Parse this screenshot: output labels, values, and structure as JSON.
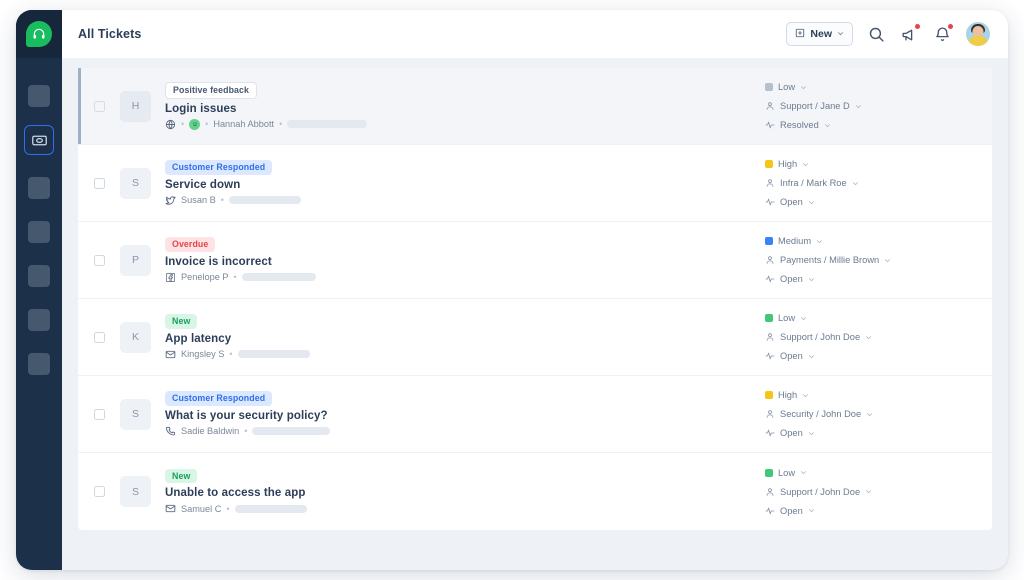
{
  "app": {
    "brand_icon": "headset-icon",
    "sidebar": {
      "items": [
        {
          "name": "nav-placeholder-1",
          "icon": "square-placeholder-icon",
          "active": false
        },
        {
          "name": "nav-tickets",
          "icon": "ticket-icon",
          "active": true
        },
        {
          "name": "nav-placeholder-3",
          "icon": "square-placeholder-icon",
          "active": false
        },
        {
          "name": "nav-placeholder-4",
          "icon": "square-placeholder-icon",
          "active": false
        },
        {
          "name": "nav-placeholder-5",
          "icon": "square-placeholder-icon",
          "active": false
        },
        {
          "name": "nav-placeholder-6",
          "icon": "square-placeholder-icon",
          "active": false
        },
        {
          "name": "nav-placeholder-7",
          "icon": "square-placeholder-icon",
          "active": false
        }
      ]
    }
  },
  "header": {
    "title": "All Tickets",
    "new_button": {
      "label": "New",
      "icon": "plus-square-icon",
      "chevron": "chevron-down-icon"
    },
    "icons": [
      {
        "name": "search-icon",
        "badge": false
      },
      {
        "name": "megaphone-icon",
        "badge": true
      },
      {
        "name": "bell-icon",
        "badge": true
      }
    ],
    "avatar": "user-avatar"
  },
  "colors": {
    "priority_low_gray": "#b6bfcc",
    "priority_low_green": "#3fc977",
    "priority_high_yellow": "#f5c518",
    "priority_medium_blue": "#3b82f6",
    "accent_blue": "#2f6fed",
    "brand_green": "#17bd5f",
    "sidebar_bg": "#1c3049"
  },
  "tickets": [
    {
      "selected": true,
      "initial": "H",
      "badge": {
        "label": "Positive feedback",
        "style": "neutral"
      },
      "title": "Login issues",
      "channel_icon": "globe-icon",
      "sentiment_icon": "smiley-happy-icon",
      "requester": "Hannah Abbott",
      "redacted_width": 80,
      "priority": {
        "label": "Low",
        "color": "#b6bfcc"
      },
      "assignee": "Support / Jane D",
      "status": "Resolved"
    },
    {
      "selected": false,
      "initial": "S",
      "badge": {
        "label": "Customer Responded",
        "style": "blue"
      },
      "title": "Service down",
      "channel_icon": "twitter-icon",
      "sentiment_icon": null,
      "requester": "Susan B",
      "redacted_width": 72,
      "priority": {
        "label": "High",
        "color": "#f5c518"
      },
      "assignee": "Infra / Mark Roe",
      "status": "Open"
    },
    {
      "selected": false,
      "initial": "P",
      "badge": {
        "label": "Overdue",
        "style": "red"
      },
      "title": "Invoice is incorrect",
      "channel_icon": "facebook-icon",
      "sentiment_icon": null,
      "requester": "Penelope P",
      "redacted_width": 74,
      "priority": {
        "label": "Medium",
        "color": "#3b82f6"
      },
      "assignee": "Payments / Millie Brown",
      "status": "Open"
    },
    {
      "selected": false,
      "initial": "K",
      "badge": {
        "label": "New",
        "style": "green"
      },
      "title": "App latency",
      "channel_icon": "email-icon",
      "sentiment_icon": null,
      "requester": "Kingsley S",
      "redacted_width": 72,
      "priority": {
        "label": "Low",
        "color": "#3fc977"
      },
      "assignee": "Support / John Doe",
      "status": "Open"
    },
    {
      "selected": false,
      "initial": "S",
      "badge": {
        "label": "Customer Responded",
        "style": "blue"
      },
      "title": "What is your security policy?",
      "channel_icon": "phone-icon",
      "sentiment_icon": null,
      "requester": "Sadie Baldwin",
      "redacted_width": 78,
      "priority": {
        "label": "High",
        "color": "#f5c518"
      },
      "assignee": "Security / John Doe",
      "status": "Open"
    },
    {
      "selected": false,
      "initial": "S",
      "badge": {
        "label": "New",
        "style": "green"
      },
      "title": "Unable to access the app",
      "channel_icon": "email-icon",
      "sentiment_icon": null,
      "requester": "Samuel C",
      "redacted_width": 72,
      "priority": {
        "label": "Low",
        "color": "#3fc977"
      },
      "assignee": "Support / John Doe",
      "status": "Open"
    }
  ],
  "meta_separator": "•"
}
